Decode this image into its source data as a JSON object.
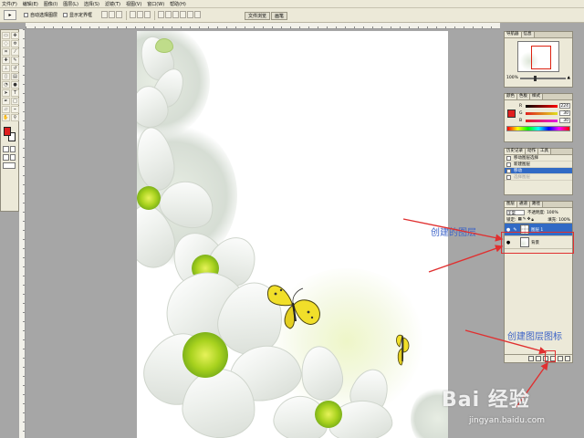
{
  "menubar": {
    "items": [
      "文件(F)",
      "编辑(E)",
      "图像(I)",
      "图层(L)",
      "选择(S)",
      "滤镜(T)",
      "视图(V)",
      "窗口(W)",
      "帮助(H)"
    ]
  },
  "options": {
    "tool_glyph": "▸",
    "auto_select": "自动选择图层",
    "show_bounds": "显示定界框",
    "palette_tabs": [
      "文件浏览",
      "画笔"
    ]
  },
  "panels": {
    "navigator": {
      "tabs": [
        "导航器",
        "信息"
      ],
      "zoom": "100%"
    },
    "color": {
      "tabs": [
        "颜色",
        "色板",
        "样式"
      ],
      "rows": [
        {
          "label": "R",
          "value": "224"
        },
        {
          "label": "G",
          "value": "30"
        },
        {
          "label": "B",
          "value": "30"
        }
      ]
    },
    "history": {
      "tabs": [
        "历史记录",
        "动作",
        "工具"
      ],
      "items": [
        "移动图层选择",
        "新建图层",
        "移动",
        "选择图层"
      ]
    },
    "layers": {
      "tabs": [
        "图层",
        "通道",
        "路径"
      ],
      "blend_mode": "正常",
      "opacity": "不透明度: 100%",
      "lock": "锁定:",
      "fill": "填充: 100%",
      "rows": [
        {
          "name": "图层 1"
        },
        {
          "name": "背景"
        }
      ]
    }
  },
  "annotations": {
    "created_layer": "创建的图层",
    "create_layer_icon": "创建图层图标"
  },
  "watermark": {
    "brand": "Bai 经验",
    "url": "jingyan.baidu.com"
  },
  "colors": {
    "foreground": "#e01e1e",
    "background": "#ffffff",
    "selection": "#316ac5",
    "annotation_text": "#3b62c7",
    "annotation_red": "#e03030"
  }
}
